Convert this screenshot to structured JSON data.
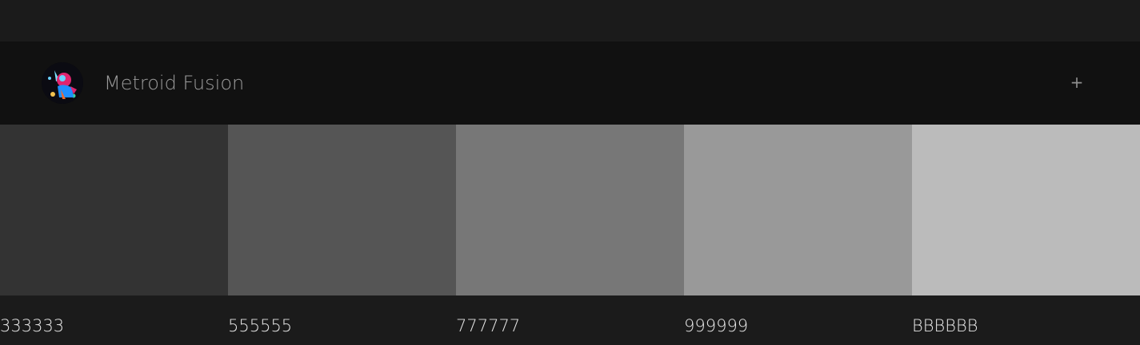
{
  "palette": {
    "title": "Metroid Fusion",
    "add_label": "+",
    "avatar_icon": "metroid-fusion-avatar-icon",
    "colors": [
      {
        "hex": "#333333",
        "label": "333333"
      },
      {
        "hex": "#555555",
        "label": "555555"
      },
      {
        "hex": "#777777",
        "label": "777777"
      },
      {
        "hex": "#999999",
        "label": "999999"
      },
      {
        "hex": "#BBBBBB",
        "label": "BBBBBB"
      }
    ]
  }
}
